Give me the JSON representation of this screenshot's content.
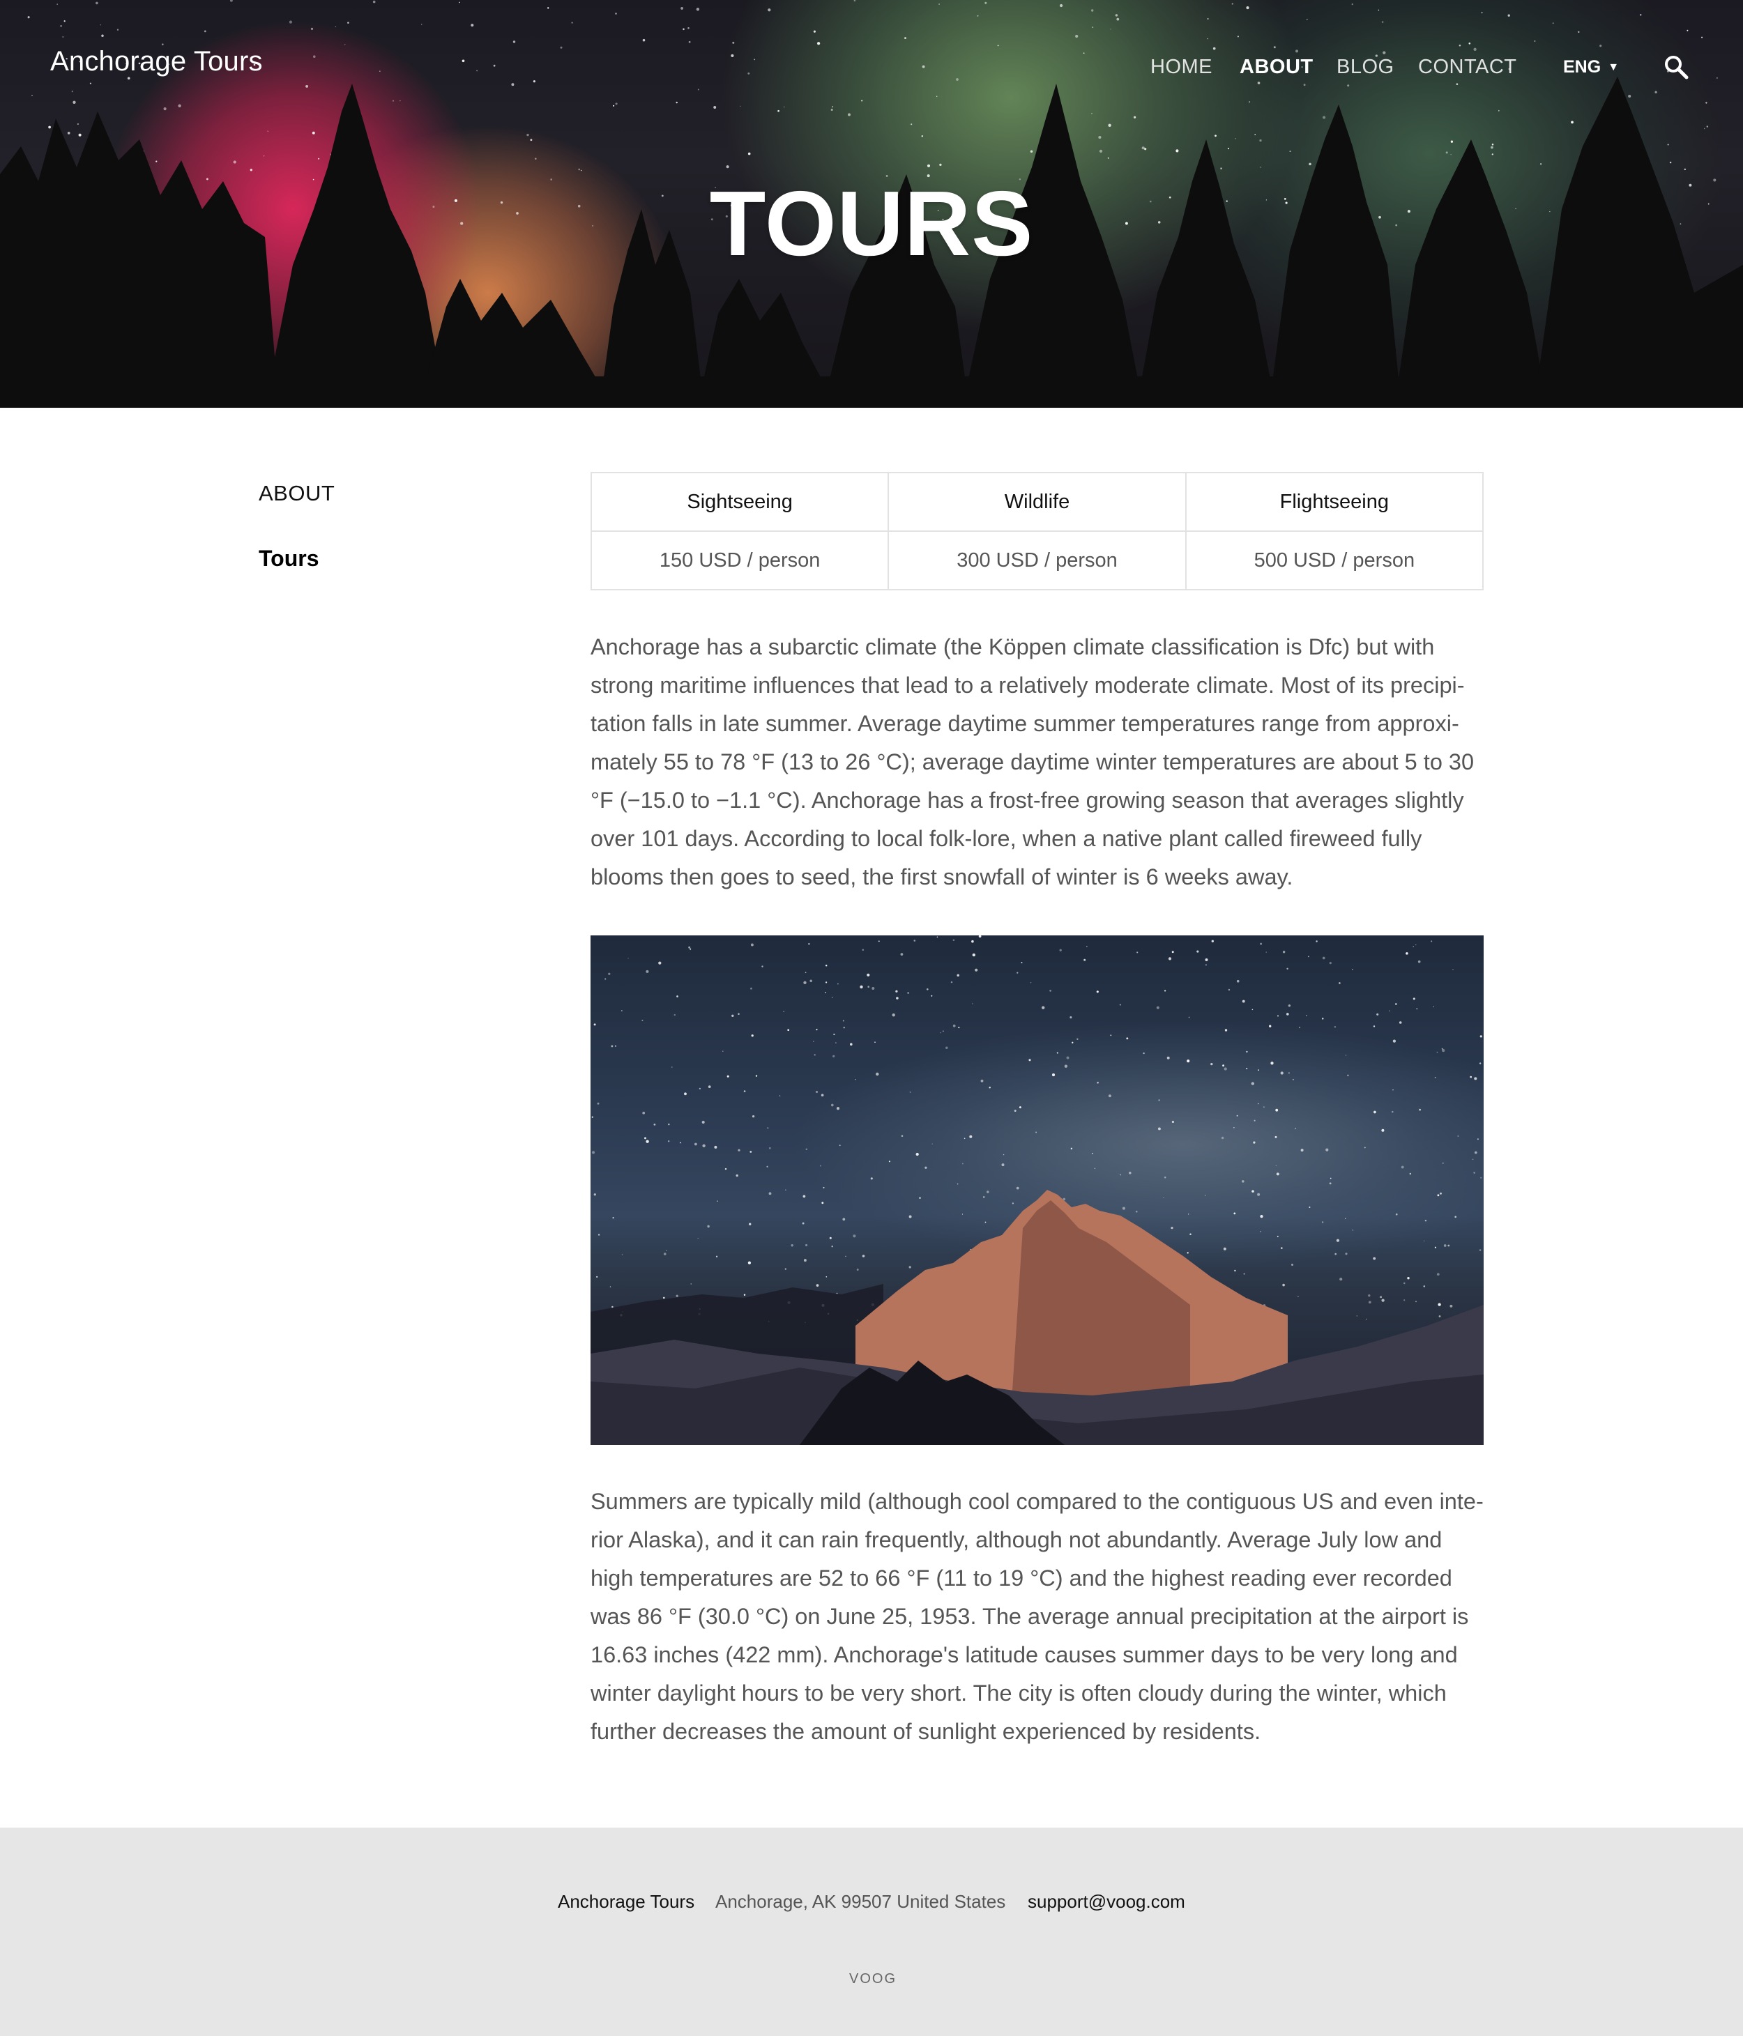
{
  "header": {
    "brand": "Anchorage Tours",
    "nav": [
      {
        "label": "HOME",
        "active": false
      },
      {
        "label": "ABOUT",
        "active": true
      },
      {
        "label": "BLOG",
        "active": false
      },
      {
        "label": "CONTACT",
        "active": false
      }
    ],
    "language": "ENG",
    "search_icon": "search-icon"
  },
  "hero": {
    "title": "TOURS"
  },
  "sidebar": {
    "items": [
      {
        "label": "ABOUT"
      },
      {
        "label": "Tours"
      }
    ]
  },
  "prices": {
    "headers": [
      "Sightseeing",
      "Wildlife",
      "Flightseeing"
    ],
    "values": [
      "150 USD / person",
      "300 USD / person",
      "500 USD / person"
    ]
  },
  "content": {
    "paragraph1": "Anchorage has a subarctic climate (the Köppen climate classification is Dfc) but with strong maritime influences that lead to a relatively moderate climate. Most of its precipi­tation falls in late summer. Average daytime summer temperatures range from approxi­mately 55 to 78 °F (13 to 26 °C); average daytime winter temperatures are about 5 to 30 °F (−15.0 to −1.1 °C). Anchorage has a frost-free growing season that averages slightly over 101 days. According to local folk-lore, when a native plant called fireweed fully blooms then goes to seed, the first snowfall of winter is 6 weeks away.",
    "paragraph2": "Summers are typically mild (although cool compared to the contiguous US and even inte­rior Alaska), and it can rain frequently, although not abundantly. Average July low and high temperatures are 52 to 66 °F (11 to 19 °C) and the highest reading ever recorded was 86 °F (30.0 °C) on June 25, 1953. The average annual precipitation at the airport is 16.63 inches (422 mm). Anchorage's latitude causes summer days to be very long and winter daylight hours to be very short. The city is often cloudy during the winter, which further decreases the amount of sunlight experienced by residents."
  },
  "footer": {
    "name": "Anchorage Tours",
    "address": "Anchorage, AK 99507 United States",
    "email": "support@voog.com",
    "logo": "VOOG"
  }
}
